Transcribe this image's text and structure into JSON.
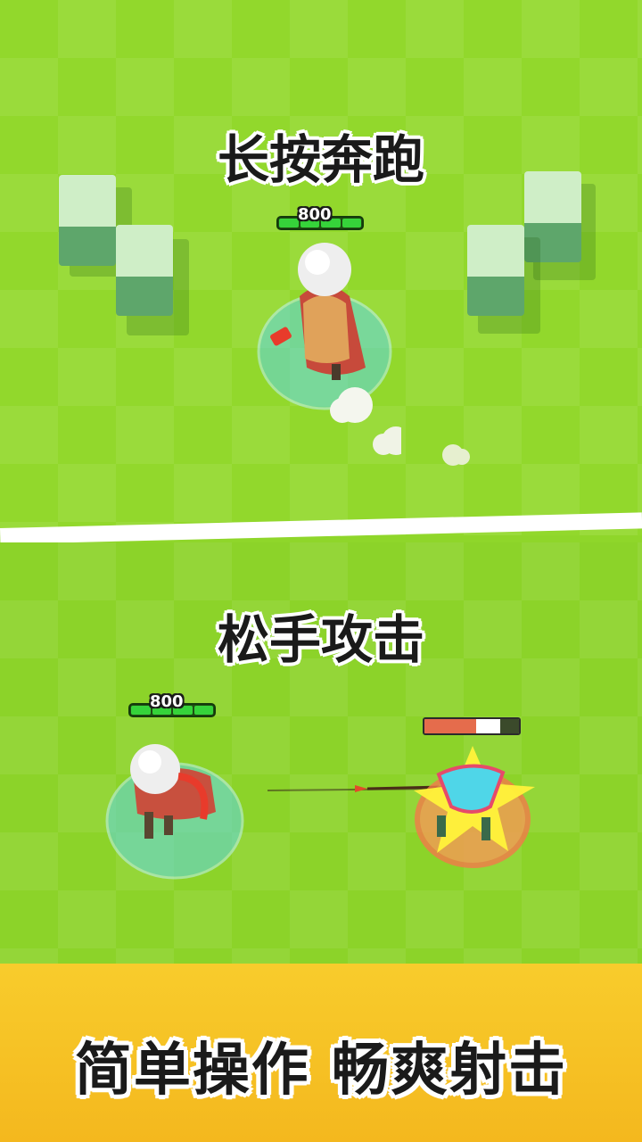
{
  "top_panel": {
    "caption": "长按奔跑",
    "player_hp": "800"
  },
  "bottom_panel": {
    "caption": "松手攻击",
    "player_hp": "800",
    "enemy_health_fraction": 0.55
  },
  "banner": {
    "text": "简单操作  畅爽射击"
  },
  "colors": {
    "grass": "#8ed52a",
    "banner": "#f6c025",
    "hp_green": "#36d33a",
    "enemy_bar": "#e56c4c"
  }
}
